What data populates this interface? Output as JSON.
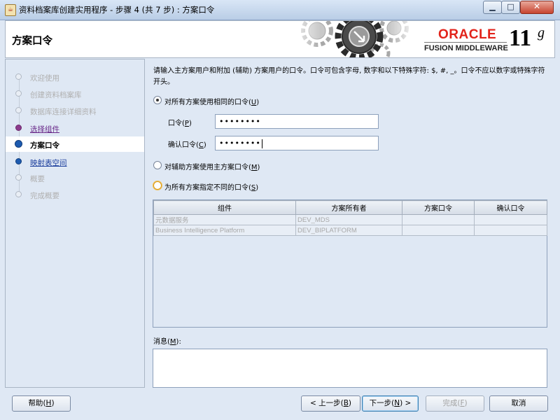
{
  "window": {
    "title": "资料档案库创建实用程序 - 步骤 4 (共 7 步) : 方案口令",
    "minimize_glyph": "▁",
    "maximize_glyph": "□",
    "close_glyph": "✕"
  },
  "header": {
    "page_title": "方案口令",
    "brand": "ORACLE",
    "product": "FUSION MIDDLEWARE",
    "version_number": "11",
    "version_suffix": "g"
  },
  "nav": {
    "items": [
      {
        "label": "欢迎使用",
        "state": "pending"
      },
      {
        "label": "创建资料档案库",
        "state": "pending"
      },
      {
        "label": "数据库连接详细资料",
        "state": "pending"
      },
      {
        "label": "选择组件",
        "state": "done"
      },
      {
        "label": "方案口令",
        "state": "current"
      },
      {
        "label": "映射表空间",
        "state": "link"
      },
      {
        "label": "概要",
        "state": "pending"
      },
      {
        "label": "完成概要",
        "state": "pending"
      }
    ]
  },
  "main": {
    "instructions": "请输入主方案用户和附加 (辅助) 方案用户的口令。口令可包含字母, 数字和以下特殊字符: $, #, _。口令不应以数字或特殊字符开头。",
    "options": {
      "same_for_all": {
        "text": "对所有方案使用相同的口令",
        "mnemonic": "U",
        "selected": true
      },
      "use_main_for_aux": {
        "text": "对辅助方案使用主方案口令",
        "mnemonic": "M",
        "selected": false
      },
      "different_for_all": {
        "text": "为所有方案指定不同的口令",
        "mnemonic": "S",
        "selected": false
      }
    },
    "password": {
      "label": "口令",
      "mnemonic": "P",
      "value": "••••••••"
    },
    "confirm_password": {
      "label": "确认口令",
      "mnemonic": "C",
      "value": "••••••••"
    },
    "table": {
      "columns": [
        "组件",
        "方案所有者",
        "方案口令",
        "确认口令"
      ],
      "rows": [
        {
          "component": "元数据服务",
          "owner": "DEV_MDS",
          "password": "",
          "confirm": ""
        },
        {
          "component": "Business Intelligence Platform",
          "owner": "DEV_BIPLATFORM",
          "password": "",
          "confirm": ""
        }
      ]
    },
    "messages_label": "消息",
    "messages_mnemonic": "M",
    "messages_text": ""
  },
  "buttons": {
    "help": {
      "text": "帮助",
      "mnemonic": "H"
    },
    "back": {
      "text": "< 上一步",
      "mnemonic": "B"
    },
    "next": {
      "text": "下一步",
      "mnemonic": "N",
      "suffix": " >"
    },
    "finish": {
      "text": "完成",
      "mnemonic": "F"
    },
    "cancel": {
      "text": "取消"
    }
  },
  "colors": {
    "oracle_red": "#e2231a",
    "selected_step": "#1d5bb0",
    "visited_step": "#8c3a8c"
  }
}
